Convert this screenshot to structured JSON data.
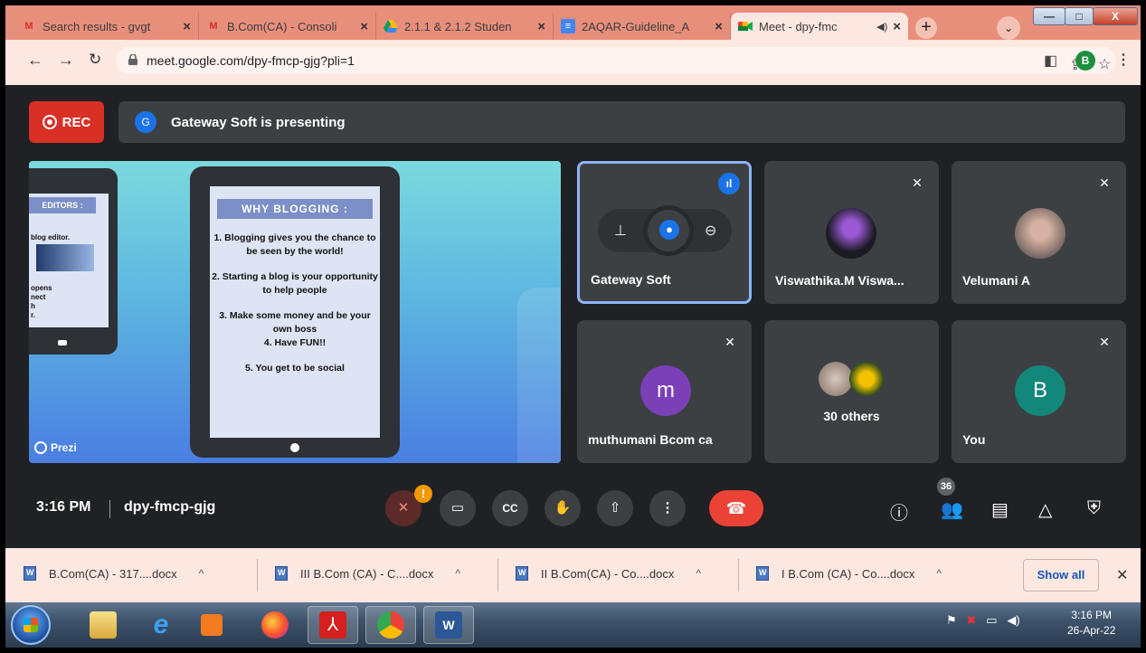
{
  "browser": {
    "tabs": [
      {
        "label": "Search results - gvgt",
        "icon": "gmail-icon"
      },
      {
        "label": "B.Com(CA) - Consoli",
        "icon": "gmail-icon"
      },
      {
        "label": "2.1.1 & 2.1.2 Studen",
        "icon": "drive-icon"
      },
      {
        "label": "2AQAR-Guideline_A",
        "icon": "docs-icon"
      },
      {
        "label": "Meet - dpy-fmc",
        "icon": "meet-icon"
      }
    ],
    "url": "meet.google.com/dpy-fmcp-gjg?pli=1",
    "profile_initial": "B"
  },
  "meet": {
    "rec_label": "REC",
    "presenter_avatar": "G",
    "presenting_text": "Gateway Soft is presenting",
    "slide": {
      "left_heading": "EDITORS :",
      "left_lines": [
        "blog editor.",
        "opens",
        "nect",
        "h",
        "r."
      ],
      "heading": "WHY BLOGGING :",
      "points": [
        "1. Blogging gives you the chance to be seen by the world!",
        "2. Starting a blog is your opportunity to help people",
        "3. Make some money and be your own boss\n4. Have FUN!!",
        "5. You get to be social"
      ],
      "brand": "Prezi"
    },
    "participants": [
      {
        "name": "Gateway Soft",
        "state": "speaking"
      },
      {
        "name": "Viswathika.M Viswa...",
        "state": "muted"
      },
      {
        "name": "Velumani A",
        "state": "muted"
      },
      {
        "name": "muthumani Bcom ca",
        "initial": "m",
        "color": "#7b3fb7",
        "state": "muted"
      },
      {
        "name": "30 others"
      },
      {
        "name": "You",
        "initial": "B",
        "color": "#12877a",
        "state": "muted"
      }
    ],
    "time": "3:16 PM",
    "meeting_code": "dpy-fmcp-gjg",
    "mic_warning": "!",
    "participant_count": "36",
    "colors": {
      "accent": "#1a73e8",
      "end_call": "#ea4335",
      "rec": "#d93025"
    }
  },
  "downloads": {
    "items": [
      "B.Com(CA) - 317....docx",
      "III B.Com (CA) - C....docx",
      "II B.Com(CA) - Co....docx",
      "I B.Com (CA) - Co....docx"
    ],
    "show_all": "Show all"
  },
  "taskbar": {
    "time": "3:16 PM",
    "date": "26-Apr-22"
  }
}
